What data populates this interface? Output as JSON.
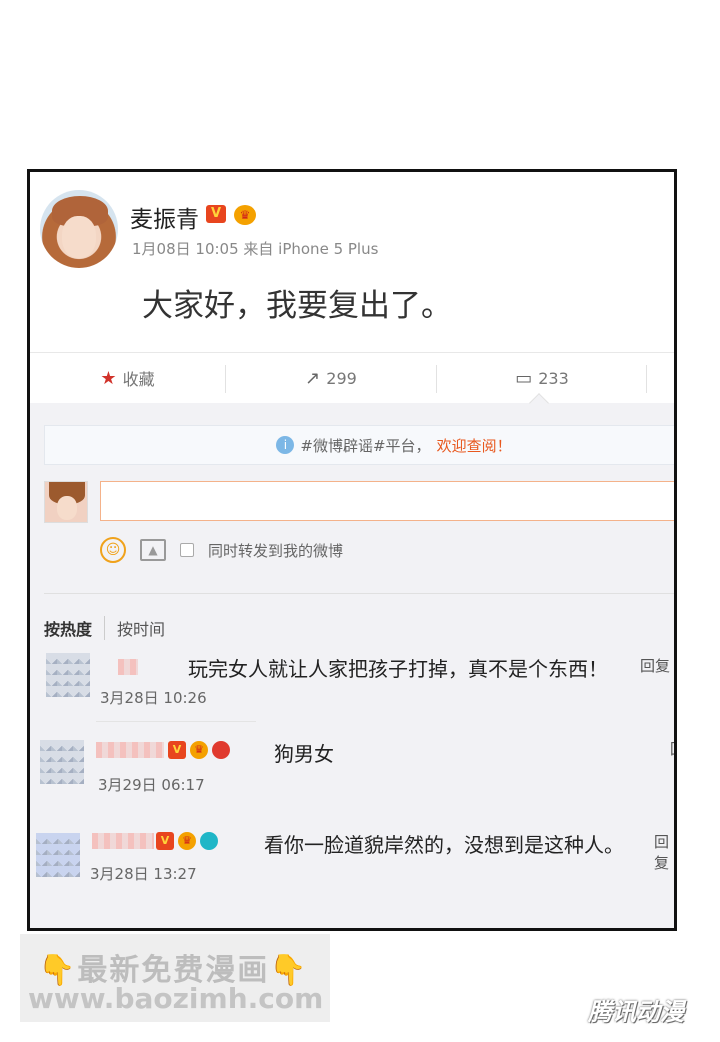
{
  "post": {
    "author": "麦振青",
    "v_badge": "V",
    "crown_badge": "♛",
    "meta": "1月08日 10:05 来自 iPhone 5 Plus",
    "content": "大家好，我要复出了。"
  },
  "toolbar": {
    "favorite_label": "收藏",
    "repost_count": "299",
    "comment_count": "233",
    "star_icon": "★",
    "repost_icon": "↗",
    "comment_icon": "▭"
  },
  "notice": {
    "icon": "i",
    "text": "#微博辟谣#平台，",
    "highlight": "欢迎查阅！"
  },
  "compose": {
    "smile_icon": "☺",
    "picture_icon": "▲",
    "repost_option": "同时转发到我的微博"
  },
  "sort": {
    "by_hot": "按热度",
    "by_time": "按时间"
  },
  "comments": [
    {
      "text": "玩完女人就让人家把孩子打掉，真不是个东西！",
      "time": "3月28日 10:26",
      "reply": "回复"
    },
    {
      "text": "狗男女",
      "time": "3月29日 06:17",
      "reply": "回"
    },
    {
      "text": "看你一脸道貌岸然的，没想到是这种人。",
      "time": "3月28日 13:27",
      "reply": "回复"
    }
  ],
  "watermark": {
    "line1": "最新免费漫画",
    "hand": "👇",
    "line2": "www.baozimh.com",
    "tencent": "腾讯动漫"
  },
  "colors": {
    "accent": "#e8581e",
    "badge_red": "#e8451e",
    "crown_gold": "#f4a100"
  }
}
